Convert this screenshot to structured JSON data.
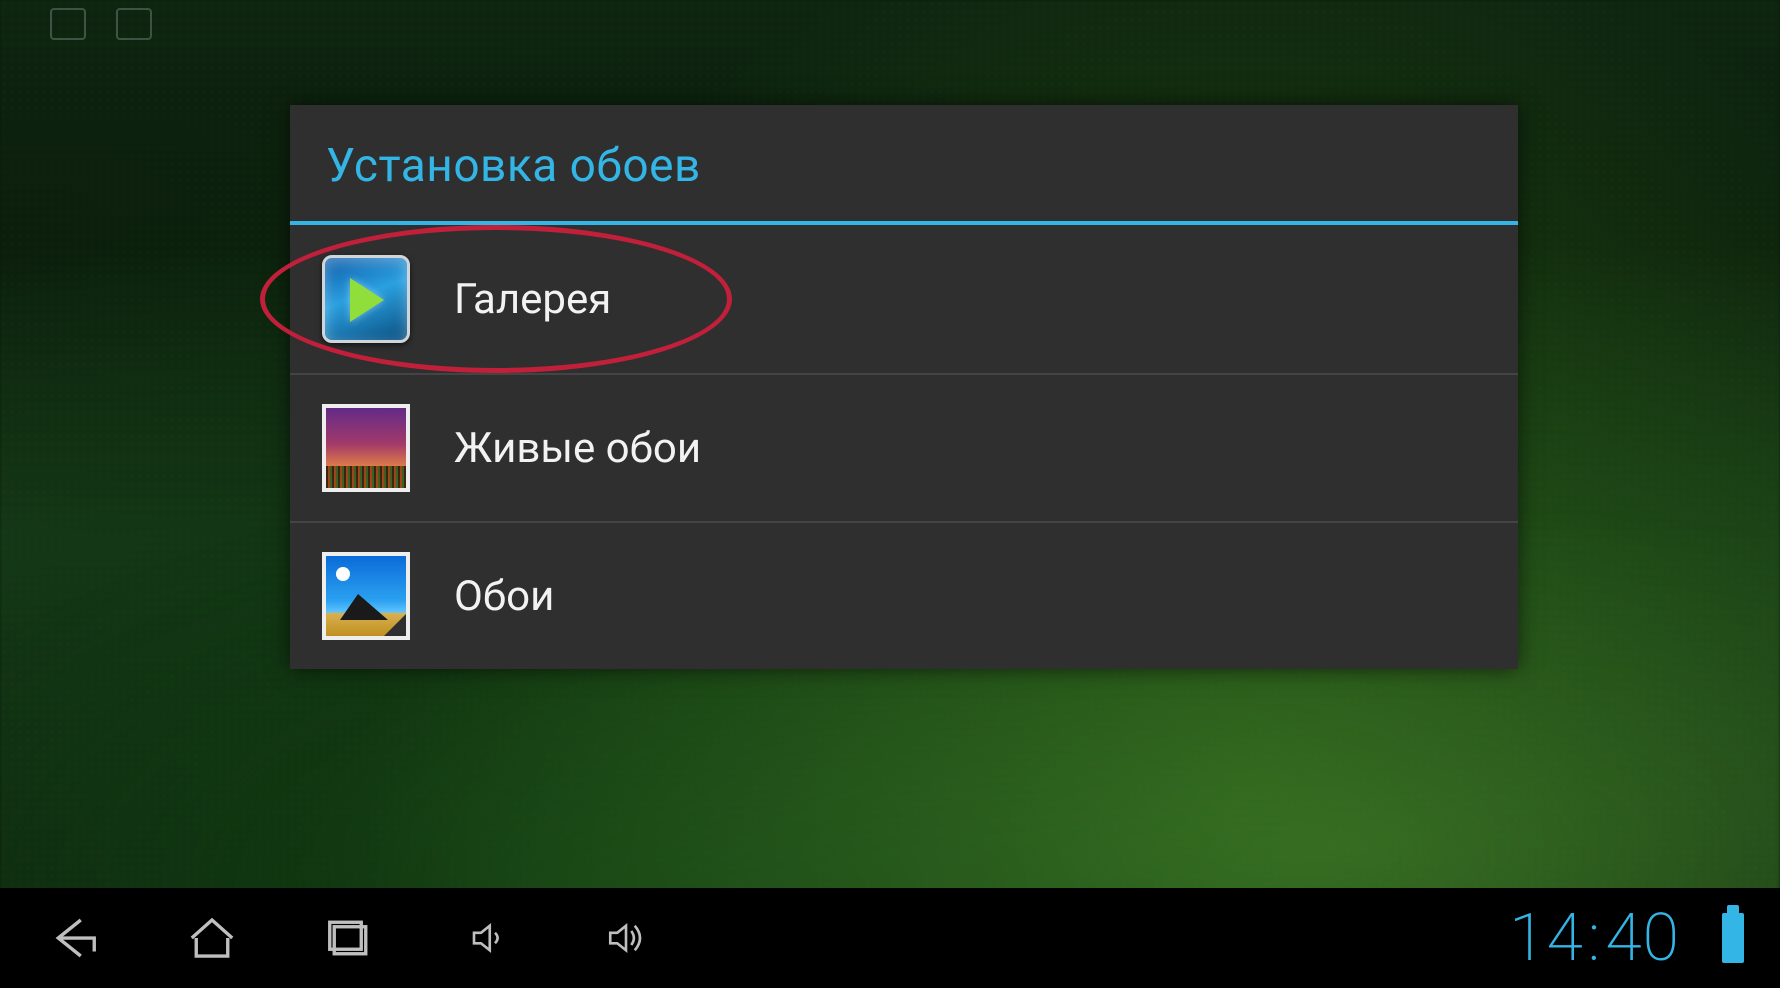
{
  "dialog": {
    "title": "Установка обоев",
    "options": {
      "gallery": "Галерея",
      "live_wallpapers": "Живые обои",
      "wallpapers": "Обои"
    }
  },
  "navbar": {
    "clock": {
      "hours": "14",
      "minutes": "40"
    }
  },
  "annotation": {
    "highlight_target": "gallery"
  },
  "colors": {
    "accent": "#33b5e5",
    "annotation": "#c2203a"
  }
}
